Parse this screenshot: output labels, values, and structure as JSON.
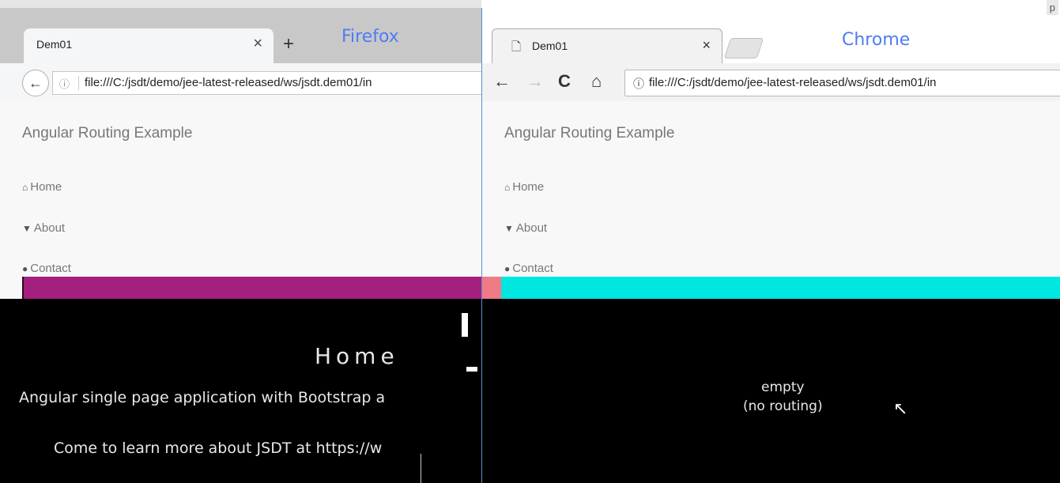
{
  "firefox": {
    "tab_title": "Dem01",
    "close_glyph": "×",
    "newtab_glyph": "+",
    "label": "Firefox",
    "back_glyph": "←",
    "info_glyph": "ⓘ",
    "url": "file:///C:/jsdt/demo/jee-latest-released/ws/jsdt.dem01/in"
  },
  "chrome": {
    "tab_title": "Dem01",
    "doc_glyph": "🗋",
    "close_glyph": "×",
    "label": "Chrome",
    "corner": "p",
    "back_glyph": "←",
    "forward_glyph": "→",
    "reload_glyph": "C",
    "home_glyph": "⌂",
    "info_glyph": "ⓘ",
    "url": "file:///C:/jsdt/demo/jee-latest-released/ws/jsdt.dem01/in"
  },
  "page": {
    "brand": "Angular Routing Example",
    "nav": {
      "home": "Home",
      "about": "About",
      "contact": "Contact",
      "home_icon": "⌂",
      "about_icon": "▼",
      "contact_icon": "●"
    },
    "firefox_view": {
      "heading": "Home",
      "lead": "Angular single page application with Bootstrap a",
      "more": "Come to learn more about JSDT at https://w"
    },
    "chrome_view": {
      "line1": "empty",
      "line2": "(no routing)"
    }
  },
  "colors": {
    "firefox_bar": "#a4207f",
    "chrome_bar": "#00e6e0",
    "browser_label": "#4f7cf5"
  }
}
